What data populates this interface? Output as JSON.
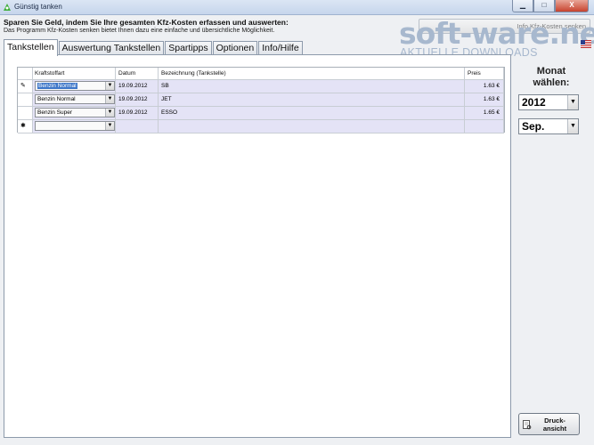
{
  "window": {
    "title": "Günstig tanken",
    "buttons": {
      "minimize": "▁",
      "maximize": "□",
      "close": "X"
    }
  },
  "header": {
    "heading": "Sparen Sie Geld, indem Sie Ihre gesamten Kfz-Kosten erfassen und auswerten:",
    "subheading": "Das Programm Kfz-Kosten senken bietet Ihnen dazu eine einfache und übersichtliche Möglichkeit.",
    "kfz_button_label": "Info  Kfz-Kosten senken"
  },
  "watermark": {
    "main": "soft-ware.net",
    "sub": "AKTUELLE DOWNLOADS"
  },
  "tabs": [
    {
      "label": "Tankstellen",
      "active": true
    },
    {
      "label": "Auswertung Tankstellen",
      "active": false
    },
    {
      "label": "Spartipps",
      "active": false
    },
    {
      "label": "Optionen",
      "active": false
    },
    {
      "label": "Info/Hilfe",
      "active": false
    }
  ],
  "grid": {
    "columns": [
      "Kraftstoffart",
      "Datum",
      "Bezeichnung (Tankstelle)",
      "Preis"
    ],
    "rows": [
      {
        "indicator": "✎",
        "kraftstoffart": "Benzin Normal",
        "datum": "19.09.2012",
        "bezeichnung": "SB",
        "preis": "1.63 €",
        "selected": true
      },
      {
        "indicator": "",
        "kraftstoffart": "Benzin Normal",
        "datum": "19.09.2012",
        "bezeichnung": "JET",
        "preis": "1.63 €",
        "selected": false
      },
      {
        "indicator": "",
        "kraftstoffart": "Benzin Super",
        "datum": "19.09.2012",
        "bezeichnung": "ESSO",
        "preis": "1.65 €",
        "selected": false
      }
    ],
    "new_row_indicator": "✱"
  },
  "sidebar": {
    "monat_label_line1": "Monat",
    "monat_label_line2": "wählen:",
    "year_value": "2012",
    "month_value": "Sep.",
    "print_label_line1": "Druck-",
    "print_label_line2": "ansicht"
  },
  "colors": {
    "row_bg": "#e4e3f6",
    "selection": "#3e77c9",
    "watermark": "#a7b8ce"
  },
  "icons": [
    "app-icon",
    "flag-icon",
    "pencil-icon",
    "new-row-icon",
    "dropdown-arrow-icon",
    "print-preview-icon"
  ]
}
